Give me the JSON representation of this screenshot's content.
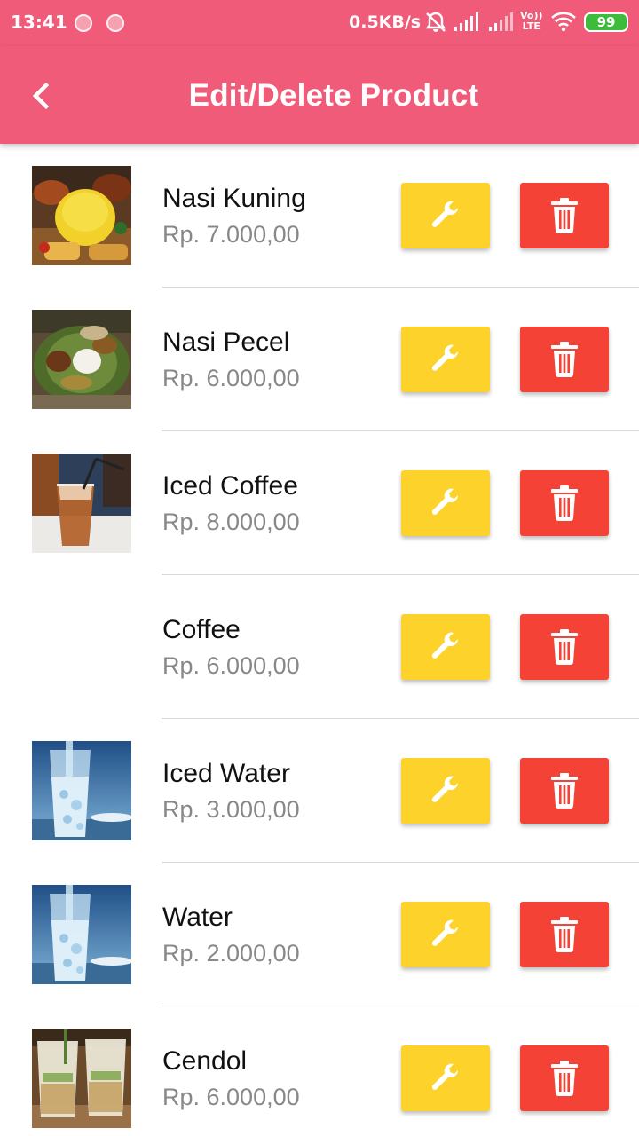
{
  "status_bar": {
    "time": "13:41",
    "speed": "0.5KB/s",
    "volte_top": "Vo))",
    "volte_bottom": "LTE",
    "battery": "99"
  },
  "app_bar": {
    "title": "Edit/Delete Product",
    "back_icon": "back-arrow-icon"
  },
  "colors": {
    "accent": "#EF5B78",
    "edit_button": "#FDD22B",
    "delete_button": "#F44336"
  },
  "products": [
    {
      "name": "Nasi Kuning",
      "price": "Rp. 7.000,00",
      "image": "nasi-kuning-photo"
    },
    {
      "name": "Nasi Pecel",
      "price": "Rp. 6.000,00",
      "image": "nasi-pecel-photo"
    },
    {
      "name": "Iced Coffee",
      "price": "Rp. 8.000,00",
      "image": "iced-coffee-photo"
    },
    {
      "name": "Coffee",
      "price": "Rp. 6.000,00",
      "image": ""
    },
    {
      "name": "Iced Water",
      "price": "Rp. 3.000,00",
      "image": "iced-water-photo"
    },
    {
      "name": "Water",
      "price": "Rp. 2.000,00",
      "image": "water-photo"
    },
    {
      "name": "Cendol",
      "price": "Rp. 6.000,00",
      "image": "cendol-photo"
    }
  ]
}
